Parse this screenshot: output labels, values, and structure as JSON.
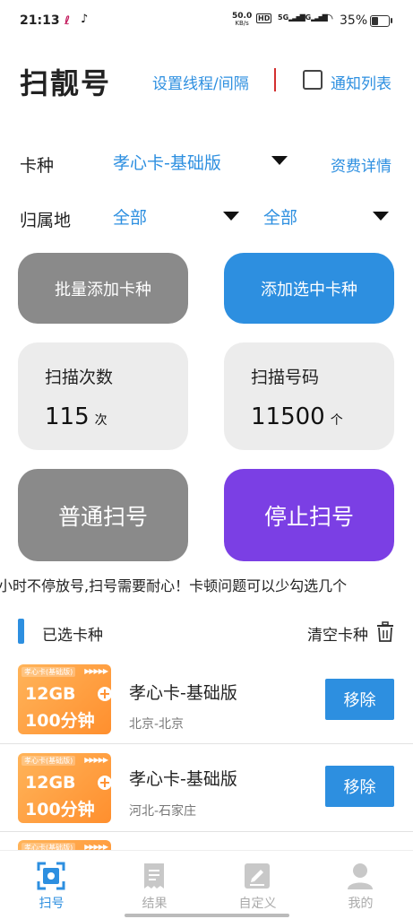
{
  "status_bar": {
    "time": "21:13",
    "net_speed": "50.0",
    "net_unit": "KB/s",
    "hd": "HD",
    "sim1": "5G",
    "sim2": "5G",
    "battery": "35%",
    "battery_level": 0.35
  },
  "header": {
    "title": "扫靓号",
    "settings_link": "设置线程/间隔",
    "notify_label": "通知列表"
  },
  "filters": {
    "card_type_label": "卡种",
    "card_type_value": "孝心卡-基础版",
    "tariff_link": "资费详情",
    "region_label": "归属地",
    "province_value": "全部",
    "city_value": "全部"
  },
  "actions": {
    "batch_add": "批量添加卡种",
    "add_selected": "添加选中卡种",
    "normal_scan": "普通扫号",
    "stop_scan": "停止扫号"
  },
  "stats": {
    "scan_count_label": "扫描次数",
    "scan_count_value": "115",
    "scan_count_unit": "次",
    "scan_numbers_label": "扫描号码",
    "scan_numbers_value": "11500",
    "scan_numbers_unit": "个"
  },
  "marquee": "小时不停放号,扫号需要耐心！卡顿问题可以少勾选几个",
  "selected": {
    "title": "已选卡种",
    "clear_label": "清空卡种",
    "items": [
      {
        "tag": "孝心卡(基础版)",
        "data": "12GB",
        "minutes": "100分钟",
        "name": "孝心卡-基础版",
        "location": "北京-北京",
        "remove": "移除"
      },
      {
        "tag": "孝心卡(基础版)",
        "data": "12GB",
        "minutes": "100分钟",
        "name": "孝心卡-基础版",
        "location": "河北-石家庄",
        "remove": "移除"
      },
      {
        "tag": "孝心卡(基础版)"
      }
    ]
  },
  "tabs": [
    {
      "label": "扫号",
      "icon": "scan-icon",
      "active": true
    },
    {
      "label": "结果",
      "icon": "receipt-icon",
      "active": false
    },
    {
      "label": "自定义",
      "icon": "edit-icon",
      "active": false
    },
    {
      "label": "我的",
      "icon": "user-icon",
      "active": false
    }
  ],
  "colors": {
    "accent": "#2d8fe0",
    "purple": "#7b3fe4",
    "gray_button": "#8a8a8a",
    "card_orange": "#ff9a3c",
    "divider_red": "#d32f2f"
  }
}
